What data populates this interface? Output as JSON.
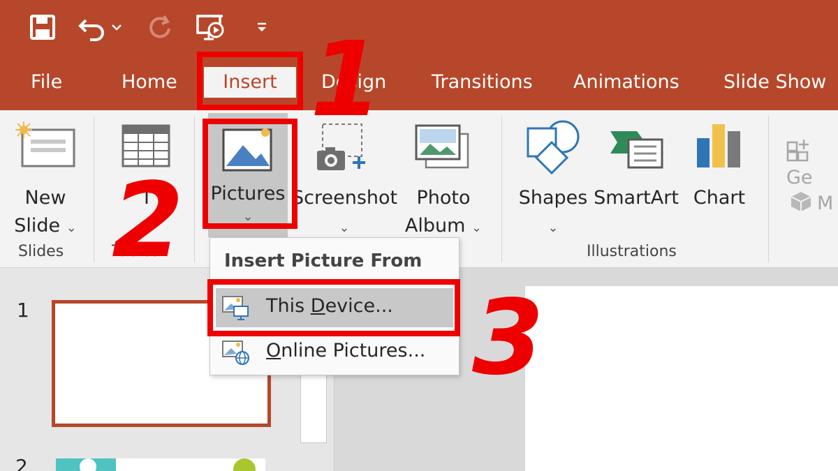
{
  "quick_access": {
    "icons": [
      "save-icon",
      "undo-icon",
      "redo-icon",
      "slideshow-from-start-icon",
      "customize-qat-icon"
    ]
  },
  "tabs": [
    {
      "label": "File"
    },
    {
      "label": "Home"
    },
    {
      "label": "Insert",
      "active": true
    },
    {
      "label": "Design"
    },
    {
      "label": "Transitions"
    },
    {
      "label": "Animations"
    },
    {
      "label": "Slide Show"
    }
  ],
  "ribbon": {
    "new_slide": {
      "line1": "New",
      "line2": "Slide"
    },
    "tables_label_fragment": "T",
    "pictures": "Pictures",
    "screenshot": "Screenshot",
    "photo_album": {
      "line1": "Photo",
      "line2": "Album"
    },
    "shapes": "Shapes",
    "smartart": "SmartArt",
    "chart": "Chart",
    "groups": {
      "slides": "Slides",
      "tables": "Tables",
      "illustrations": "Illustrations"
    },
    "greyed_right": {
      "top": "Ge",
      "bottom": "M"
    }
  },
  "dropdown": {
    "header": "Insert Picture From",
    "items": [
      {
        "pre": "This ",
        "accel": "D",
        "post": "evice...",
        "highlighted": true
      },
      {
        "pre": "",
        "accel": "O",
        "post": "nline Pictures...",
        "highlighted": false
      }
    ]
  },
  "slides_pane": {
    "numbers": [
      "1",
      "2"
    ]
  },
  "annotations": [
    "1",
    "2",
    "3"
  ],
  "colors": {
    "accent": "#b7472a",
    "annotation_red": "#ee0000",
    "ribbon_bg": "#f3f3f3"
  }
}
